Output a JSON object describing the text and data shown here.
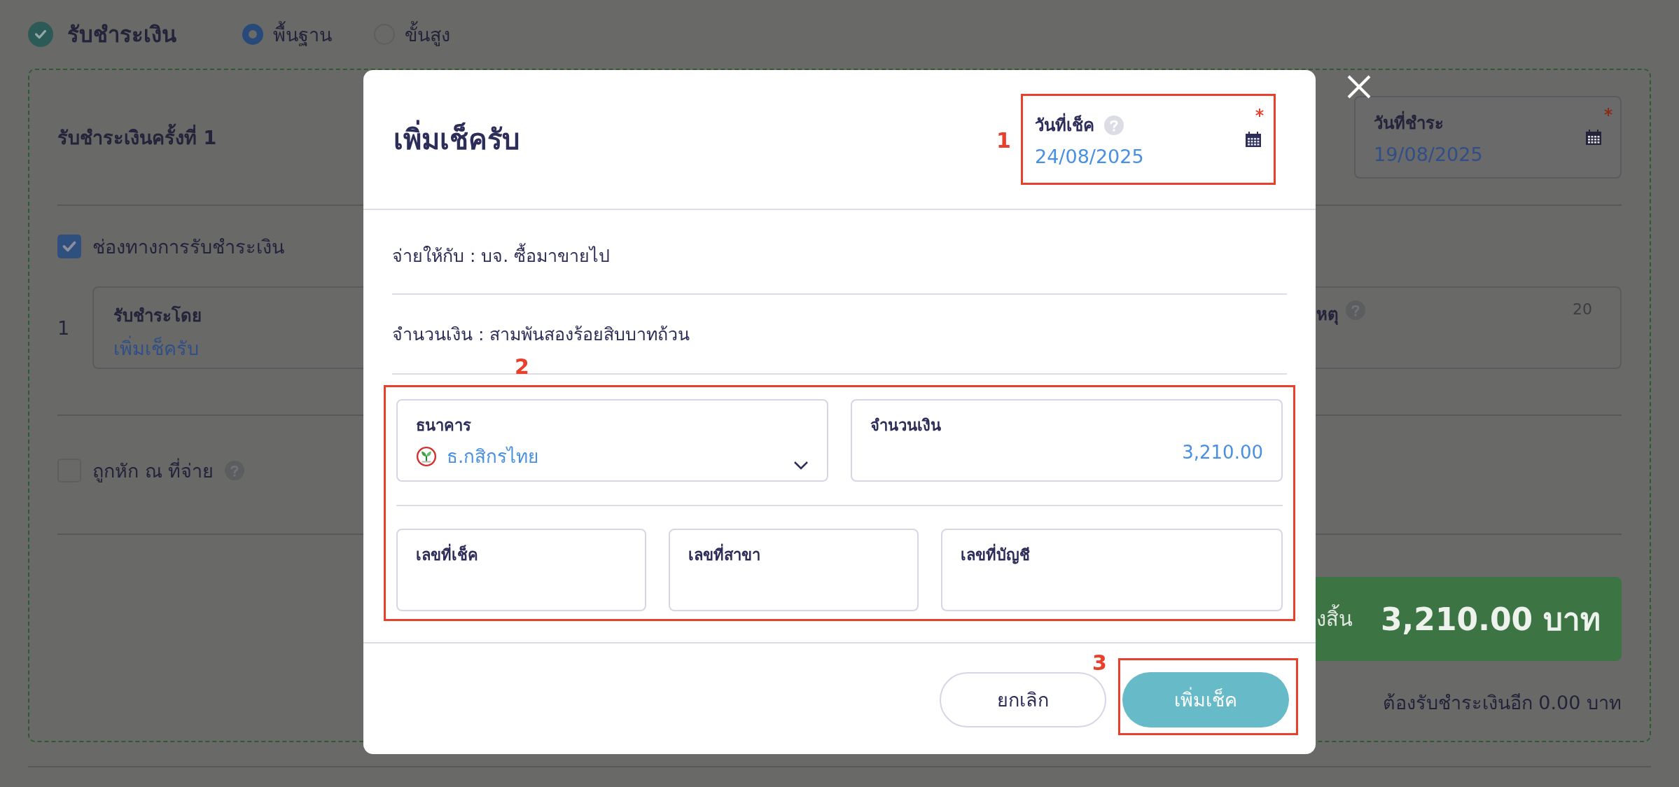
{
  "header": {
    "title": "รับชำระเงิน",
    "checked": true,
    "modes": [
      {
        "label": "พื้นฐาน",
        "selected": true
      },
      {
        "label": "ขั้นสูง",
        "selected": false
      }
    ]
  },
  "payment_card": {
    "title": "รับชำระเงินครั้งที่ 1",
    "payment_date": {
      "label": "วันที่ชำระ",
      "value": "19/08/2025",
      "required": true
    },
    "channels": {
      "label": "ช่องทางการรับชำระเงิน",
      "checked": true
    },
    "rows": [
      {
        "number": "1",
        "method_label": "รับชำระโดย",
        "method_value": "เพิ่มเช็ครับ",
        "remark_label": "หตุ",
        "remark_count": "20"
      }
    ],
    "withholding": {
      "label": "ถูกหัก ณ ที่จ่าย",
      "checked": false
    },
    "total": {
      "label": "งสิ้น",
      "amount": "3,210.00 บาท"
    },
    "remaining": "ต้องรับชำระเงินอีก 0.00 บาท"
  },
  "dialog": {
    "title": "เพิ่มเช็ครับ",
    "check_date": {
      "label": "วันที่เช็ค",
      "value": "24/08/2025",
      "required": true
    },
    "payee": "จ่ายให้กับ : บจ. ซื้อมาขายไป",
    "amount_words": "จำนวนเงิน : สามพันสองร้อยสิบบาทถ้วน",
    "bank": {
      "label": "ธนาคาร",
      "value": "ธ.กสิกรไทย"
    },
    "amount": {
      "label": "จำนวนเงิน",
      "value": "3,210.00"
    },
    "fields": [
      {
        "label": "เลขที่เช็ค"
      },
      {
        "label": "เลขที่สาขา"
      },
      {
        "label": "เลขที่บัญชี"
      }
    ],
    "buttons": [
      {
        "label": "ยกเลิก",
        "kind": "secondary"
      },
      {
        "label": "เพิ่มเช็ค",
        "kind": "primary"
      }
    ]
  },
  "annotations": [
    "1",
    "2",
    "3"
  ]
}
